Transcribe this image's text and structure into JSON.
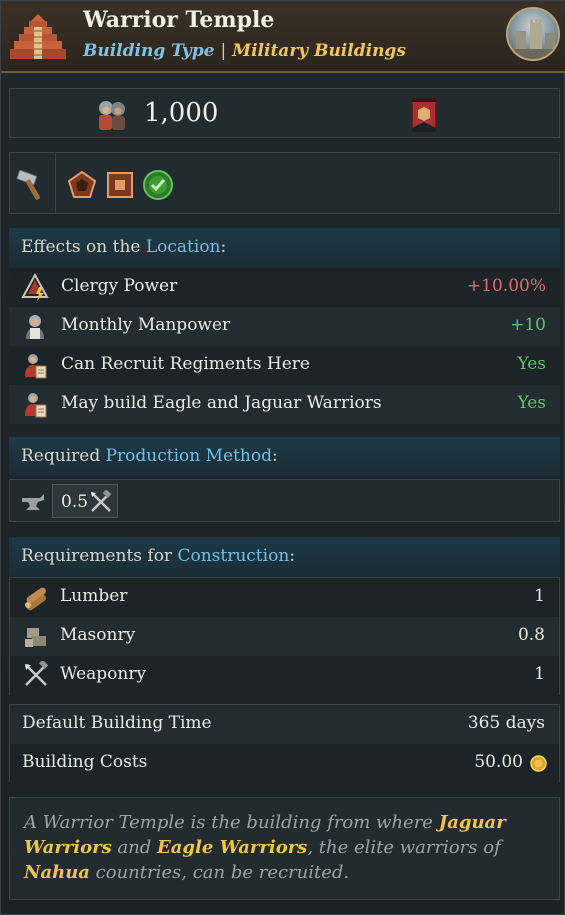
{
  "header": {
    "title": "Warrior Temple",
    "building_type_label": "Building Type",
    "separator": "|",
    "category": "Military Buildings",
    "icon": "stepped-pyramid-icon",
    "avatar": "castle-portrait"
  },
  "stats": {
    "manpower_value": "1,000",
    "manpower_icon": "soldiers-icon",
    "banner_icon": "regiment-banner-icon"
  },
  "tags": {
    "hammer_icon": "hammer-icon",
    "icons": [
      "pentagon-badge-icon",
      "square-badge-icon",
      "green-check-icon"
    ]
  },
  "effects": {
    "head_prefix": "Effects on the ",
    "head_link": "Location",
    "head_suffix": ":",
    "rows": [
      {
        "label": "Clergy Power",
        "value": "+10.00%",
        "icon": "clergy-power-icon",
        "color": "#e36a6a"
      },
      {
        "label": "Monthly Manpower",
        "value": "+10",
        "icon": "manpower-icon",
        "color": "#62c46a"
      },
      {
        "label": "Can Recruit Regiments Here",
        "value": "Yes",
        "icon": "recruit-icon",
        "color": "#62c46a"
      },
      {
        "label": "May build Eagle and Jaguar Warriors",
        "value": "Yes",
        "icon": "recruit-icon",
        "color": "#62c46a"
      }
    ]
  },
  "production": {
    "head_prefix": "Required ",
    "head_link": "Production Method",
    "head_suffix": ":",
    "value": "0.5",
    "icon": "anvil-icon",
    "chip_icon": "weaponry-icon"
  },
  "construction": {
    "head_prefix": "Requirements for ",
    "head_link": "Construction",
    "head_suffix": ":",
    "rows": [
      {
        "label": "Lumber",
        "value": "1",
        "icon": "lumber-icon"
      },
      {
        "label": "Masonry",
        "value": "0.8",
        "icon": "masonry-icon"
      },
      {
        "label": "Weaponry",
        "value": "1",
        "icon": "weaponry-icon"
      }
    ]
  },
  "footer": {
    "time_label": "Default Building Time",
    "time_value": "365 days",
    "cost_label": "Building Costs",
    "cost_value": "50.00",
    "cost_icon": "gold-coin-icon"
  },
  "description": {
    "p1": "A Warrior Temple is the building from where ",
    "b1": "Jaguar Warriors",
    "p2": " and ",
    "b2": "Eagle Warriors",
    "p3": ", the elite warriors of ",
    "b3": "Nahua",
    "p4": " countries, can be recruited."
  },
  "colors": {
    "accent_blue": "#6fc0e6",
    "accent_gold": "#f0c34c",
    "negative": "#e36a6a",
    "positive": "#62c46a"
  }
}
